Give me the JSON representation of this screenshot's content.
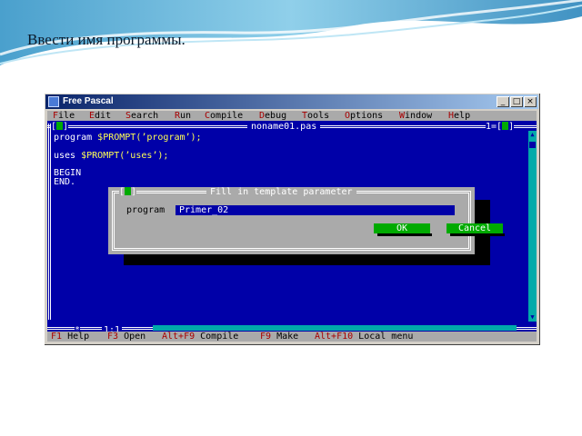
{
  "slide": {
    "title": "Ввести имя программы."
  },
  "window": {
    "title": "Free Pascal",
    "minimize_glyph": "_",
    "maximize_glyph": "□",
    "close_glyph": "×"
  },
  "menu": {
    "items": [
      {
        "hotkey": "F",
        "rest": "ile"
      },
      {
        "hotkey": "E",
        "rest": "dit"
      },
      {
        "hotkey": "S",
        "rest": "earch"
      },
      {
        "hotkey": "R",
        "rest": "un"
      },
      {
        "hotkey": "C",
        "rest": "ompile"
      },
      {
        "hotkey": "D",
        "rest": "ebug"
      },
      {
        "hotkey": "T",
        "rest": "ools"
      },
      {
        "hotkey": "O",
        "rest": "ptions"
      },
      {
        "hotkey": "W",
        "rest": "indow"
      },
      {
        "hotkey": "H",
        "rest": "elp"
      }
    ]
  },
  "editor": {
    "filename": "noname01.pas",
    "window_number": "1=[",
    "window_number_end": "]",
    "close_marker": "[",
    "close_marker_end": "]",
    "code_lines": [
      {
        "kw": "program ",
        "macro": "$PROMPT(’program’);"
      },
      {
        "kw": "uses ",
        "macro": "$PROMPT(’uses’);"
      },
      {
        "kw": "BEGIN",
        "macro": ""
      },
      {
        "kw": "END.",
        "macro": ""
      }
    ],
    "cursor_position": "1:1",
    "modified_marker": "*"
  },
  "dialog": {
    "title": "Fill in template parameter",
    "close_marker": "[",
    "close_marker_end": "]",
    "label": "program",
    "value": "Primer_02",
    "ok_label": "OK",
    "cancel_label": "Cancel"
  },
  "statusbar": {
    "items": [
      {
        "key": "F1",
        "label": " Help"
      },
      {
        "key": "F3",
        "label": " Open"
      },
      {
        "key": "Alt+F9",
        "label": " Compile"
      },
      {
        "key": "F9",
        "label": " Make"
      },
      {
        "key": "Alt+F10",
        "label": " Local menu"
      }
    ]
  },
  "colors": {
    "editor_bg": "#0000a8",
    "menu_bg": "#aaaaaa",
    "hotkey": "#a80000",
    "button_green": "#00aa00",
    "scroll_cyan": "#00aaaa"
  }
}
